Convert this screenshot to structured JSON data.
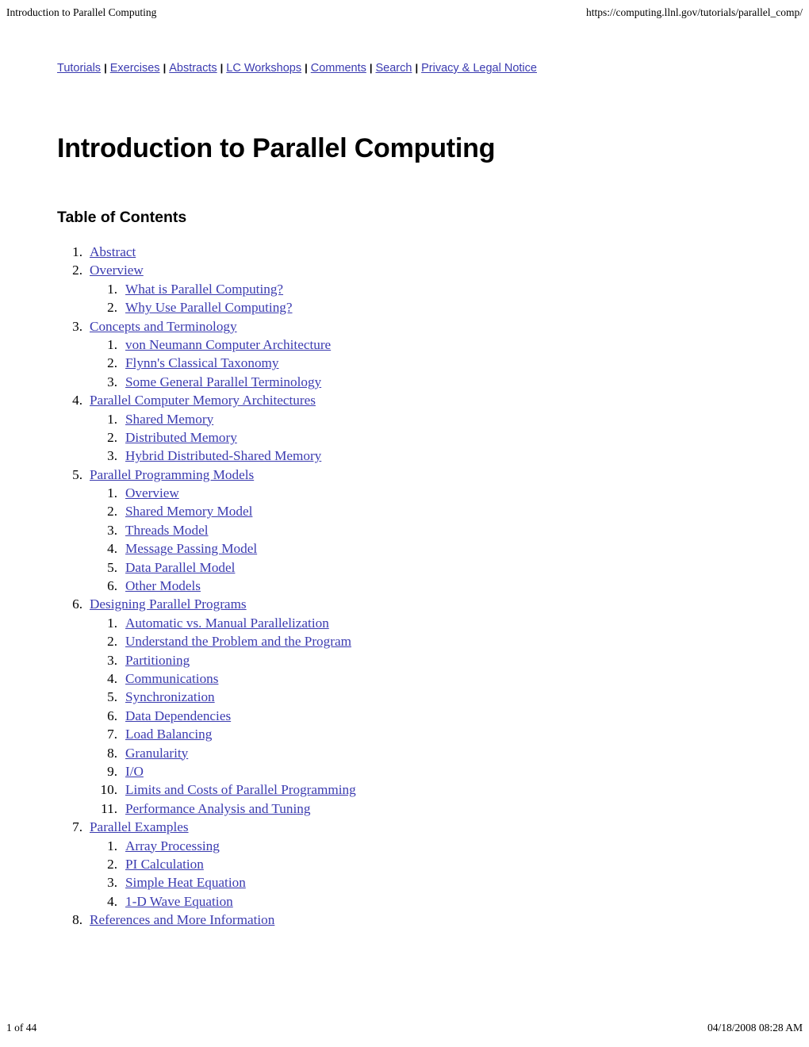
{
  "print_header": {
    "left": "Introduction to Parallel Computing",
    "right": "https://computing.llnl.gov/tutorials/parallel_comp/"
  },
  "navigation": {
    "separator": "|",
    "links": [
      {
        "label": "Tutorials"
      },
      {
        "label": "Exercises"
      },
      {
        "label": "Abstracts"
      },
      {
        "label": "LC Workshops"
      },
      {
        "label": "Comments"
      },
      {
        "label": "Search"
      },
      {
        "label": "Privacy & Legal Notice"
      }
    ]
  },
  "document": {
    "title": "Introduction to Parallel Computing",
    "toc_heading": "Table of Contents",
    "link_color": "#3b3bb0",
    "text_color": "#000000"
  },
  "toc": [
    {
      "level": 1,
      "number": "1.",
      "label": "Abstract"
    },
    {
      "level": 1,
      "number": "2.",
      "label": "Overview"
    },
    {
      "level": 2,
      "number": "1.",
      "label": "What is Parallel Computing?"
    },
    {
      "level": 2,
      "number": "2.",
      "label": "Why Use Parallel Computing?"
    },
    {
      "level": 1,
      "number": "3.",
      "label": "Concepts and Terminology"
    },
    {
      "level": 2,
      "number": "1.",
      "label": "von Neumann Computer Architecture"
    },
    {
      "level": 2,
      "number": "2.",
      "label": "Flynn's Classical Taxonomy"
    },
    {
      "level": 2,
      "number": "3.",
      "label": "Some General Parallel Terminology"
    },
    {
      "level": 1,
      "number": "4.",
      "label": "Parallel Computer Memory Architectures"
    },
    {
      "level": 2,
      "number": "1.",
      "label": "Shared Memory"
    },
    {
      "level": 2,
      "number": "2.",
      "label": "Distributed Memory"
    },
    {
      "level": 2,
      "number": "3.",
      "label": "Hybrid Distributed-Shared Memory"
    },
    {
      "level": 1,
      "number": "5.",
      "label": "Parallel Programming Models"
    },
    {
      "level": 2,
      "number": "1.",
      "label": "Overview"
    },
    {
      "level": 2,
      "number": "2.",
      "label": "Shared Memory Model"
    },
    {
      "level": 2,
      "number": "3.",
      "label": "Threads Model"
    },
    {
      "level": 2,
      "number": "4.",
      "label": "Message Passing Model"
    },
    {
      "level": 2,
      "number": "5.",
      "label": "Data Parallel Model"
    },
    {
      "level": 2,
      "number": "6.",
      "label": "Other Models"
    },
    {
      "level": 1,
      "number": "6.",
      "label": "Designing Parallel Programs"
    },
    {
      "level": 2,
      "number": "1.",
      "label": "Automatic vs. Manual Parallelization"
    },
    {
      "level": 2,
      "number": "2.",
      "label": "Understand the Problem and the Program"
    },
    {
      "level": 2,
      "number": "3.",
      "label": "Partitioning"
    },
    {
      "level": 2,
      "number": "4.",
      "label": "Communications"
    },
    {
      "level": 2,
      "number": "5.",
      "label": "Synchronization"
    },
    {
      "level": 2,
      "number": "6.",
      "label": "Data Dependencies"
    },
    {
      "level": 2,
      "number": "7.",
      "label": "Load Balancing"
    },
    {
      "level": 2,
      "number": "8.",
      "label": "Granularity"
    },
    {
      "level": 2,
      "number": "9.",
      "label": "I/O"
    },
    {
      "level": 2,
      "number": "10.",
      "label": "Limits and Costs of Parallel Programming"
    },
    {
      "level": 2,
      "number": "11.",
      "label": "Performance Analysis and Tuning"
    },
    {
      "level": 1,
      "number": "7.",
      "label": "Parallel Examples"
    },
    {
      "level": 2,
      "number": "1.",
      "label": "Array Processing"
    },
    {
      "level": 2,
      "number": "2.",
      "label": "PI Calculation"
    },
    {
      "level": 2,
      "number": "3.",
      "label": "Simple Heat Equation"
    },
    {
      "level": 2,
      "number": "4.",
      "label": "1-D Wave Equation"
    },
    {
      "level": 1,
      "number": "8.",
      "label": "References and More Information"
    }
  ],
  "print_footer": {
    "left": "1 of 44",
    "right": "04/18/2008 08:28 AM"
  }
}
